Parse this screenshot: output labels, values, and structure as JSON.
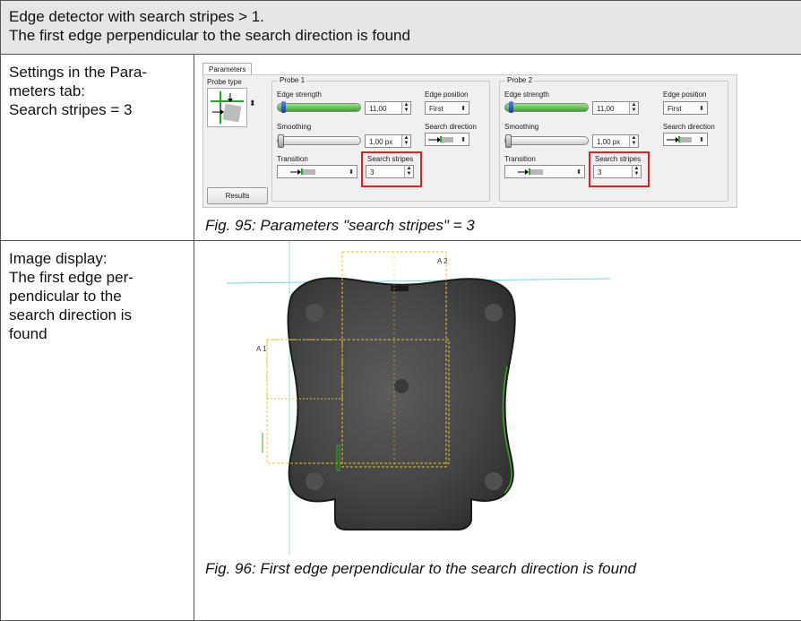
{
  "header": {
    "line1": "Edge detector with search stripes > 1.",
    "line2": "The first edge perpendicular to the search direction is found"
  },
  "row1": {
    "left": [
      "Settings in the Para-",
      "meters tab:",
      "Search stripes = 3"
    ],
    "caption": "Fig. 95: Parameters \"search stripes\" = 3"
  },
  "params_ui": {
    "tab_label": "Parameters",
    "probe_type_label": "Probe type",
    "results_button": "Results",
    "probe1": {
      "title": "Probe 1",
      "edge_strength_label": "Edge strength",
      "edge_strength_value": "11,00",
      "edge_position_label": "Edge position",
      "edge_position_value": "First",
      "smoothing_label": "Smoothing",
      "smoothing_value": "1,00 px",
      "search_direction_label": "Search direction",
      "transition_label": "Transition",
      "search_stripes_label": "Search stripes",
      "search_stripes_value": "3"
    },
    "probe2": {
      "title": "Probe 2",
      "edge_strength_label": "Edge strength",
      "edge_strength_value": "11,00",
      "edge_position_label": "Edge position",
      "edge_position_value": "First",
      "smoothing_label": "Smoothing",
      "smoothing_value": "1,00 px",
      "search_direction_label": "Search direction",
      "transition_label": "Transition",
      "search_stripes_label": "Search stripes",
      "search_stripes_value": "3"
    },
    "accent_green": "#3aa42a",
    "highlight_red": "#dd2222"
  },
  "row2": {
    "left": [
      "Image display:",
      "The first edge per-",
      "pendicular to the",
      "search direction is",
      "found"
    ],
    "caption": "Fig. 96: First edge perpendicular to the search direction is found",
    "probe_marker_1": "A 2",
    "probe_marker_2": "A 1"
  }
}
